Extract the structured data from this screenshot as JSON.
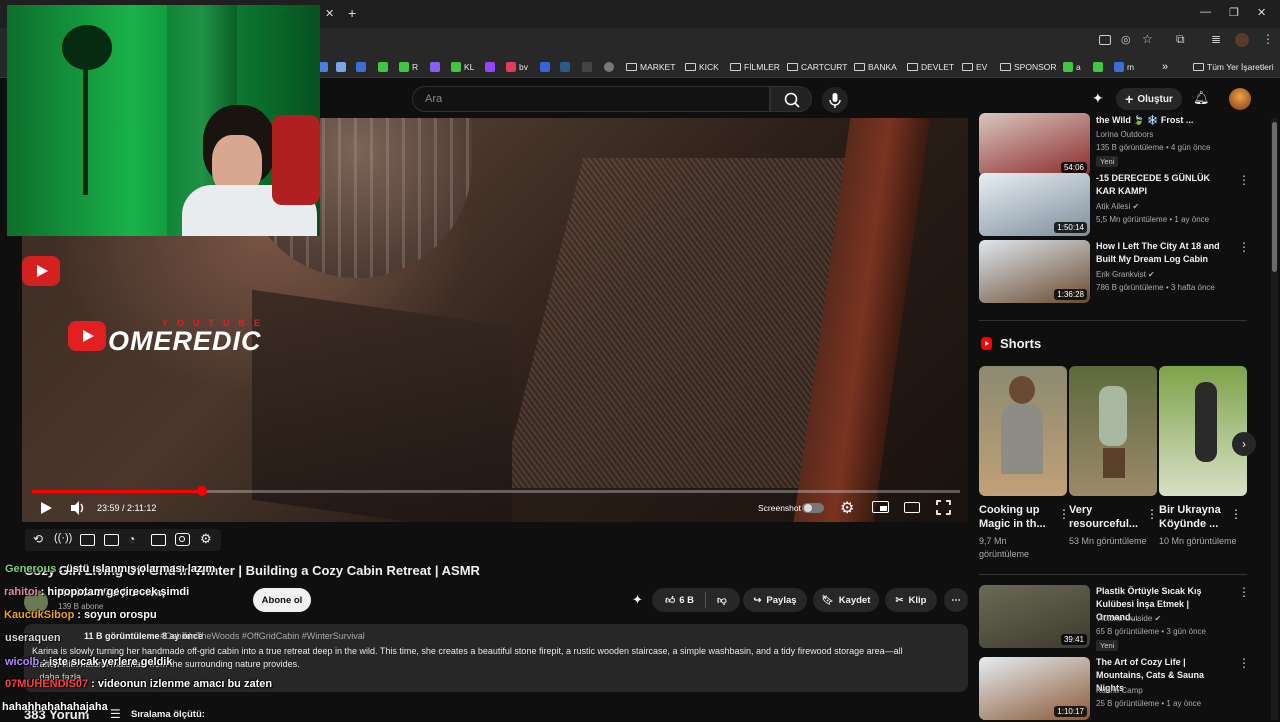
{
  "browser": {
    "bookmarks": [
      "MARKET",
      "KICK",
      "FİLMLER",
      "CARTCURT",
      "BANKA",
      "DEVLET",
      "EV",
      "SPONSOR"
    ],
    "bookmark_icons": [
      {
        "label": "R"
      },
      {
        "label": "KL"
      },
      {
        "label": "bv"
      },
      {
        "label": "a"
      },
      {
        "label": "m"
      }
    ],
    "all_bookmarks": "Tüm Yer İşaretleri",
    "more": "»"
  },
  "header": {
    "search_placeholder": "Ara",
    "create_label": "Oluştur"
  },
  "player": {
    "time": "23:59 / 2:11:12",
    "screenshot_label": "Screenshot",
    "progress_fraction": 0.183,
    "watermark_small": "YOUTUBE",
    "watermark_big": "OMEREDIC"
  },
  "video": {
    "title": "Cozy Girl Living Off Grid in Winter | Building a Cozy Cabin Retreat | ASMR",
    "channel": "Karina Wild Survival",
    "subscribers": "139 B abone",
    "subscribe_label": "Abone ol",
    "likes": "6 B",
    "share_label": "Paylaş",
    "save_label": "Kaydet",
    "clip_label": "Klip",
    "views_line": "11 B görüntüleme  8 ay önce",
    "hashtags": "#CabinInTheWoods #OffGridCabin #WinterSurvival",
    "description": "Karina is slowly turning her handmade off-grid cabin into a true retreat deep in the wild. This time, she creates a beautiful stone firepit, a rustic wooden staircase, a simple washbasin, and a tidy firewood storage area—all",
    "description_line2": "crafted with natural materials from the surrounding nature provides.",
    "more_label": "...daha fazla",
    "comments_count": "383 Yorum",
    "sort_label": "Sıralama ölçütü:"
  },
  "recommended": [
    {
      "title": "the Wild 🍃 ❄️ Frost ...",
      "channel": "Lorina Outdoors",
      "meta": "135 B görüntüleme • 4 gün önce",
      "badge": "Yeni",
      "duration": "54:06",
      "colors": [
        "#d9c7c0",
        "#8b2a2a"
      ]
    },
    {
      "title": "-15 DERECEDE 5 GÜNLÜK KAR KAMPI",
      "channel": "Atik Ailesi ✔",
      "meta": "5,5 Mn görüntüleme • 1 ay önce",
      "duration": "1:50:14",
      "colors": [
        "#e8eef4",
        "#7d8e9c"
      ]
    },
    {
      "title": "How I Left The City At 18 and Built My Dream Log Cabin",
      "channel": "Erik Grankvist ✔",
      "meta": "786 B görüntüleme • 3 hafta önce",
      "duration": "1:36:28",
      "colors": [
        "#dfe7ef",
        "#6a4a2e"
      ]
    },
    {
      "title": "Plastik Örtüyle Sıcak Kış Kulübesi İnşa Etmek | Ormand...",
      "channel": "Victoria Outside ✔",
      "meta": "65 B görüntüleme • 3 gün önce",
      "badge": "Yeni",
      "duration": "39:41",
      "colors": [
        "#6b6a55",
        "#3d3a2c"
      ]
    },
    {
      "title": "The Art of Cozy Life | Mountains, Cats & Sauna Nights",
      "channel": "Karina Camp",
      "meta": "25 B görüntüleme • 1 ay önce",
      "duration": "1:10:17",
      "colors": [
        "#e6edf3",
        "#8a5a36"
      ]
    }
  ],
  "shorts": {
    "heading": "Shorts",
    "items": [
      {
        "title": "Cooking up Magic in th...",
        "views": "9,7 Mn görüntüleme",
        "colors": [
          "#8b8a70",
          "#c2a078"
        ]
      },
      {
        "title": "Very resourceful...",
        "views": "53 Mn görüntüleme",
        "colors": [
          "#5d6a3c",
          "#9b8a6a"
        ]
      },
      {
        "title": "Bir Ukrayna Köyünde ...",
        "views": "10 Mn görüntüleme",
        "colors": [
          "#7ea34a",
          "#d8e0c6"
        ]
      }
    ]
  },
  "chat": [
    {
      "user": "Generous",
      "message": ": üstü ıslanmış olarması lazım",
      "color": "#7fd07f"
    },
    {
      "user": "rahitoi",
      "message": ": hipopotam geçirecek şimdi",
      "color": "#e48aa8"
    },
    {
      "user": "KaucukSibop",
      "message": ": soyun orospu",
      "color": "#f0a020"
    },
    {
      "user": "useraquen",
      "message": "",
      "color": "#d8d8d8"
    },
    {
      "user": "wicolb",
      "message": ": işte sıcak yerlere geldik",
      "color": "#b887ff"
    },
    {
      "user": "07MUHENDIS07",
      "message": ": videonun izlenme amacı bu zaten",
      "color": "#ff4040"
    },
    {
      "user": "hahahhahahahajaha",
      "message": "",
      "color": "#ffffff"
    }
  ],
  "colors": {
    "accent": "#ff0000",
    "background": "#0f0f0f",
    "pill": "#272727"
  }
}
